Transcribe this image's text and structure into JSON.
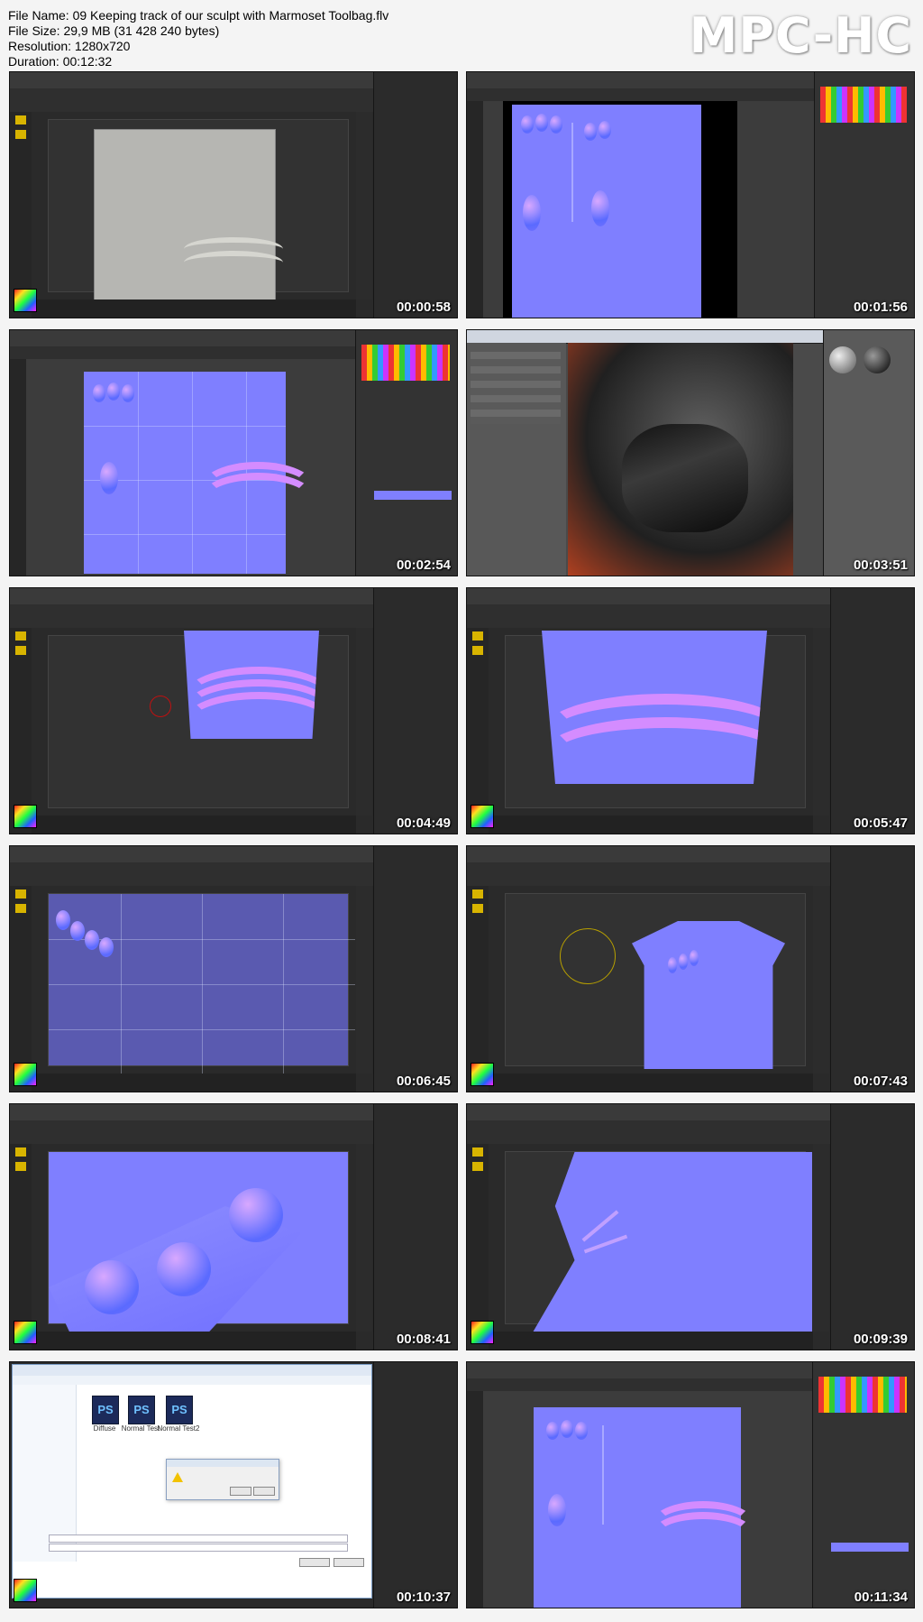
{
  "header": {
    "file_name": "File Name: 09 Keeping track of our sculpt with Marmoset Toolbag.flv",
    "file_size": "File Size: 29,9 MB (31 428 240 bytes)",
    "resolution": "Resolution: 1280x720",
    "duration": "Duration: 00:12:32"
  },
  "logo": "MPC-HC",
  "thumbnails": [
    {
      "timestamp": "00:00:58"
    },
    {
      "timestamp": "00:01:56"
    },
    {
      "timestamp": "00:02:54"
    },
    {
      "timestamp": "00:03:51"
    },
    {
      "timestamp": "00:04:49"
    },
    {
      "timestamp": "00:05:47"
    },
    {
      "timestamp": "00:06:45"
    },
    {
      "timestamp": "00:07:43"
    },
    {
      "timestamp": "00:08:41"
    },
    {
      "timestamp": "00:09:39"
    },
    {
      "timestamp": "00:10:37"
    },
    {
      "timestamp": "00:11:34"
    }
  ],
  "colors": {
    "normal_map": "#7f7fff",
    "ui_dark": "#2a2a2a",
    "accent_yellow": "#d8b400",
    "accent_red": "#c01010"
  },
  "dialog": {
    "files": [
      "Diffuse",
      "Normal Test",
      "Normal Test2"
    ],
    "icon_text": "PS"
  }
}
